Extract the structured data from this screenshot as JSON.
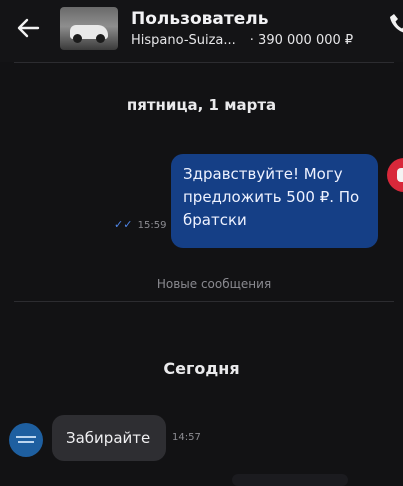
{
  "header": {
    "back_icon": "arrow-left-icon",
    "title": "Пользователь",
    "listing_name": "Hispano-Suiza...",
    "listing_price": "· 390 000 000 ₽",
    "thumbnail_icon": "car-photo",
    "call_icon": "phone-icon"
  },
  "chat": {
    "date_separator": "пятница, 1 марта",
    "outgoing": {
      "text": "Здравствуйте! Могу предложить 500 ₽. По братски",
      "time": "15:59",
      "status_icon": "double-check-icon"
    },
    "new_messages_label": "Новые сообщения",
    "today_separator": "Сегодня",
    "incoming": {
      "text": "Забирайте",
      "time": "14:57"
    }
  },
  "colors": {
    "background": "#121214",
    "outgoing_bubble": "#153f86",
    "incoming_bubble": "#2e2e32",
    "read_check": "#4f86e8"
  }
}
